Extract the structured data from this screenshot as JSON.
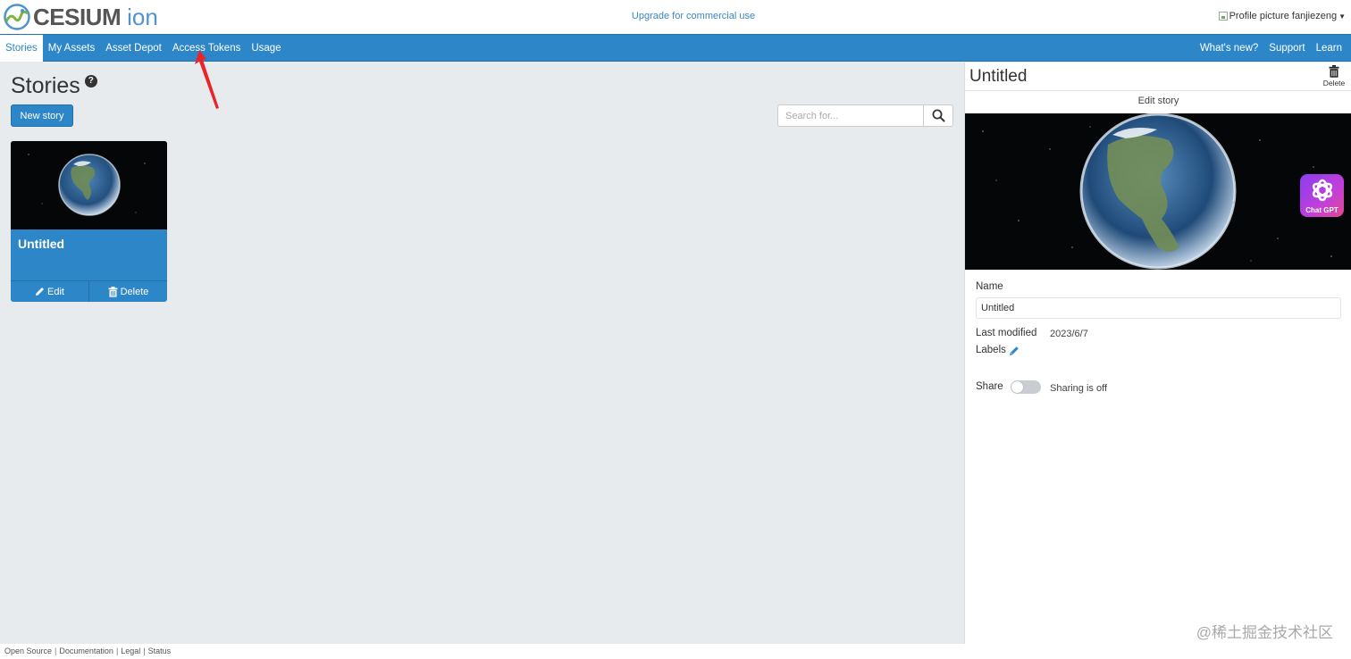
{
  "header": {
    "logo_text": "CESIUM",
    "logo_suffix": "ion",
    "upgrade_link": "Upgrade for commercial use",
    "profile_alt": "Profile picture",
    "username": "fanjiezeng"
  },
  "nav": {
    "left": [
      {
        "label": "Stories",
        "active": true
      },
      {
        "label": "My Assets"
      },
      {
        "label": "Asset Depot"
      },
      {
        "label": "Access Tokens"
      },
      {
        "label": "Usage"
      }
    ],
    "right": [
      {
        "label": "What's new?"
      },
      {
        "label": "Support"
      },
      {
        "label": "Learn"
      }
    ]
  },
  "main": {
    "title": "Stories",
    "help": "?",
    "new_story_label": "New story",
    "search_placeholder": "Search for...",
    "cards": [
      {
        "title": "Untitled",
        "edit_label": "Edit",
        "delete_label": "Delete"
      }
    ]
  },
  "panel": {
    "title": "Untitled",
    "delete_label": "Delete",
    "edit_story_label": "Edit story",
    "chatgpt_label": "Chat GPT",
    "name_label": "Name",
    "name_value": "Untitled",
    "last_modified_label": "Last modified",
    "last_modified_value": "2023/6/7",
    "labels_label": "Labels",
    "share_label": "Share",
    "share_status": "Sharing is off",
    "share_on": false
  },
  "watermark": "@稀土掘金技术社区",
  "footer": {
    "links": [
      "Open Source",
      "Documentation",
      "Legal",
      "Status"
    ]
  },
  "colors": {
    "brand_blue": "#2d86c8",
    "link_blue": "#3a86c8",
    "annotation_red": "#e8262a"
  }
}
